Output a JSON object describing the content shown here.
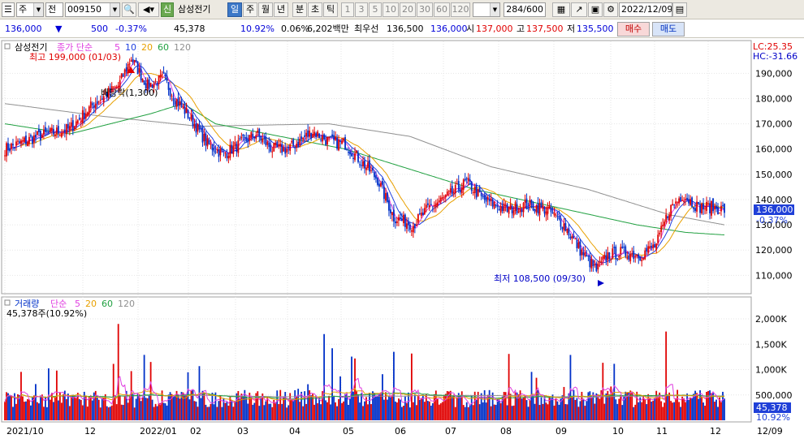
{
  "toolbar": {
    "mode": "주",
    "mode2": "전",
    "code": "009150",
    "name_badge": "신",
    "name": "삼성전기",
    "periods": [
      "일",
      "주",
      "월",
      "년",
      "분",
      "초",
      "틱"
    ],
    "numbers": [
      "1",
      "3",
      "5",
      "10",
      "20",
      "30",
      "60",
      "120"
    ],
    "count": "284",
    "count_total": "/600",
    "date": "2022/12/09"
  },
  "quote": {
    "price": "136,000",
    "arrow": "▼",
    "change": "500",
    "change_pct": "-0.37%",
    "volume": "45,378",
    "vol_ratio": "10.92%",
    "turnover": "0.06%",
    "amount": "6,202백만",
    "best_ask_label": "최우선",
    "best_ask": "136,500",
    "best_bid": "136,000",
    "open_label": "시",
    "open": "137,000",
    "high_label": "고",
    "high": "137,500",
    "low_label": "저",
    "low": "135,500",
    "buy_label": "매수",
    "sell_label": "매도"
  },
  "price_panel": {
    "legend_name": "삼성전기",
    "legend_ma": "종가 단순",
    "ma_periods": [
      "5",
      "10",
      "20",
      "60",
      "120"
    ],
    "ma_colors": [
      "#e040e0",
      "#2040e0",
      "#e8a000",
      "#20a040",
      "#909090"
    ],
    "max_label": "최고 199,000 (01/03)",
    "min_label": "최저 108,500 (09/30)",
    "dividend_label": "배당락(1,300)",
    "lc": "LC:25.35",
    "hc": "HC:-31.66",
    "y_ticks": [
      "190,000",
      "180,000",
      "170,000",
      "160,000",
      "150,000",
      "140,000",
      "130,000",
      "120,000",
      "110,000"
    ],
    "current": "136,000",
    "current_pct": "-0.37%"
  },
  "volume_panel": {
    "legend_name": "거래량",
    "legend_ma": "단순",
    "ma_periods": [
      "5",
      "20",
      "60",
      "120"
    ],
    "vol_value": "45,378주(10.92%)",
    "y_ticks": [
      "2,000K",
      "1,500K",
      "1,000K",
      "500,000"
    ],
    "current": "45,378",
    "current_pct": "10.92%"
  },
  "x_axis": {
    "labels": [
      "2021/10",
      "12",
      "2022/01",
      "02",
      "03",
      "04",
      "05",
      "06",
      "07",
      "08",
      "09",
      "10",
      "11",
      "12",
      "12/09"
    ]
  },
  "colors": {
    "up": "#e00000",
    "down": "#0030c8",
    "accent": "#3c78c8"
  },
  "chart_data": {
    "type": "candlestick",
    "y_range": [
      104000,
      202000
    ],
    "vol_range": [
      0,
      2400000
    ],
    "close_keypoints": [
      [
        0,
        160000
      ],
      [
        20,
        165000
      ],
      [
        40,
        168000
      ],
      [
        55,
        178000
      ],
      [
        70,
        185000
      ],
      [
        78,
        196000
      ],
      [
        88,
        185000
      ],
      [
        98,
        188000
      ],
      [
        105,
        180000
      ],
      [
        115,
        172000
      ],
      [
        125,
        162000
      ],
      [
        135,
        158000
      ],
      [
        145,
        162000
      ],
      [
        155,
        166000
      ],
      [
        165,
        160000
      ],
      [
        175,
        160000
      ],
      [
        190,
        167000
      ],
      [
        200,
        163000
      ],
      [
        210,
        162000
      ],
      [
        220,
        155000
      ],
      [
        230,
        148000
      ],
      [
        240,
        133000
      ],
      [
        252,
        130000
      ],
      [
        262,
        137000
      ],
      [
        275,
        142000
      ],
      [
        285,
        147000
      ],
      [
        295,
        140000
      ],
      [
        310,
        136000
      ],
      [
        322,
        138000
      ],
      [
        335,
        136000
      ],
      [
        345,
        130000
      ],
      [
        355,
        120000
      ],
      [
        365,
        112000
      ],
      [
        372,
        118000
      ],
      [
        380,
        119000
      ],
      [
        392,
        118000
      ],
      [
        402,
        122000
      ],
      [
        410,
        136000
      ],
      [
        418,
        142000
      ],
      [
        428,
        137000
      ],
      [
        436,
        137000
      ],
      [
        444,
        136000
      ]
    ],
    "ma120_keypoints": [
      [
        0,
        178000
      ],
      [
        60,
        173000
      ],
      [
        120,
        169000
      ],
      [
        200,
        170000
      ],
      [
        250,
        165000
      ],
      [
        300,
        153000
      ],
      [
        360,
        144000
      ],
      [
        410,
        134000
      ],
      [
        444,
        130000
      ]
    ],
    "ma60_keypoints": [
      [
        0,
        170000
      ],
      [
        40,
        166000
      ],
      [
        90,
        174000
      ],
      [
        110,
        178000
      ],
      [
        130,
        170000
      ],
      [
        170,
        165000
      ],
      [
        210,
        160000
      ],
      [
        250,
        152000
      ],
      [
        290,
        144000
      ],
      [
        340,
        137000
      ],
      [
        390,
        130000
      ],
      [
        420,
        127000
      ],
      [
        444,
        126000
      ]
    ]
  }
}
